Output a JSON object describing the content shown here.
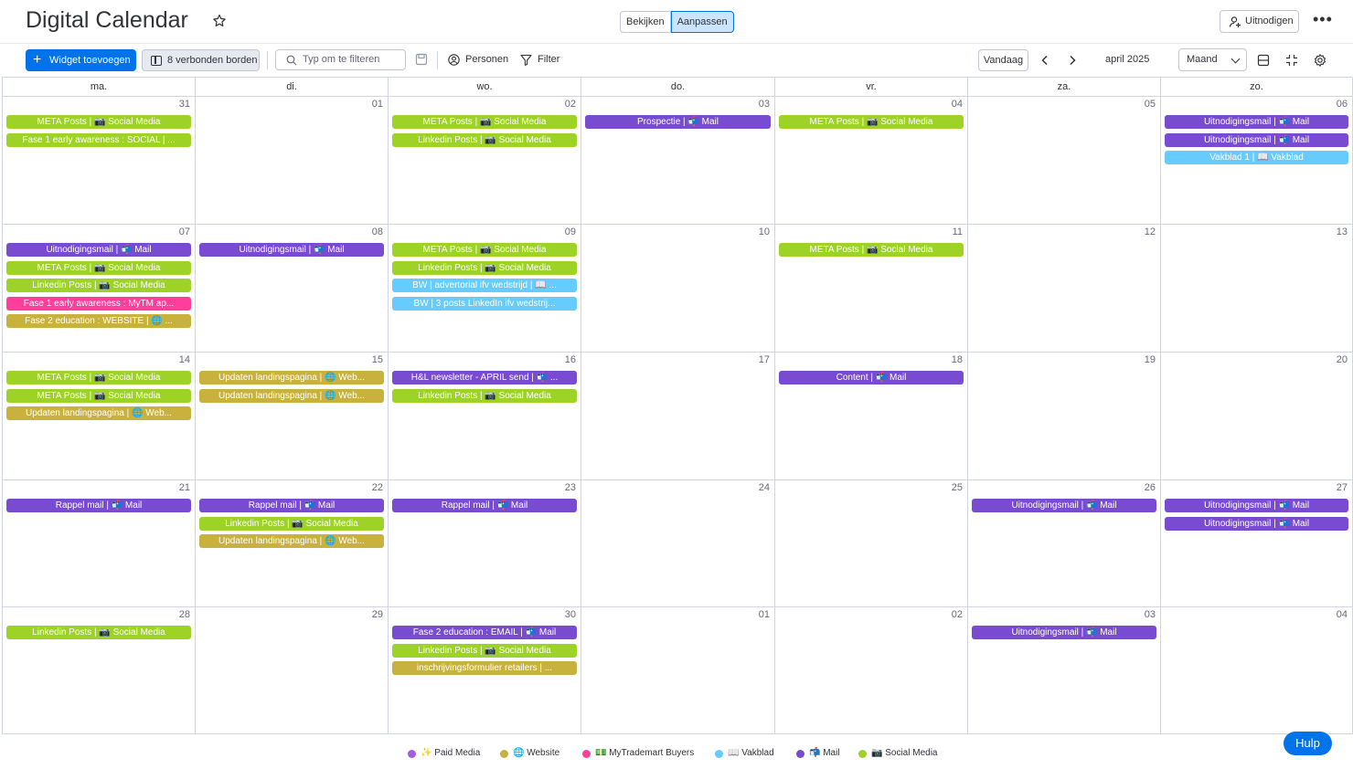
{
  "header": {
    "title": "Digital Calendar",
    "view_toggle": [
      "Bekijken",
      "Aanpassen"
    ],
    "invite_label": "Uitnodigen",
    "more_label": "•••"
  },
  "toolbar": {
    "add_widget_label": "Widget toevoegen",
    "connected_boards_label": "8 verbonden borden",
    "filter_placeholder": "Typ om te filteren",
    "persons_label": "Personen",
    "filter_label": "Filter",
    "today_label": "Vandaag",
    "month_label": "april 2025",
    "view_select_value": "Maand"
  },
  "colors": {
    "social": "#9cd326",
    "mail": "#784bd1",
    "vakblad": "#66ccff",
    "mytrademart": "#ff3d9a",
    "website": "#c9b13d",
    "paid": "#a25ddc",
    "accent": "#0073ea"
  },
  "calendar": {
    "days_of_week": [
      "ma.",
      "di.",
      "wo.",
      "do.",
      "vr.",
      "za.",
      "zo."
    ],
    "weeks": [
      [
        {
          "day": "31",
          "events": [
            {
              "title": "META Posts |  📷  Social Media",
              "type": "social"
            },
            {
              "title": "Fase 1 early awareness : SOCIAL | ...",
              "type": "social"
            }
          ]
        },
        {
          "day": "01",
          "events": []
        },
        {
          "day": "02",
          "events": [
            {
              "title": "META Posts |  📷  Social Media",
              "type": "social"
            },
            {
              "title": "Linkedin Posts |  📷  Social Media",
              "type": "social"
            }
          ]
        },
        {
          "day": "03",
          "events": [
            {
              "title": "Prospectie |  📬  Mail",
              "type": "mail"
            }
          ]
        },
        {
          "day": "04",
          "events": [
            {
              "title": "META Posts |  📷  Social Media",
              "type": "social"
            }
          ]
        },
        {
          "day": "05",
          "events": []
        },
        {
          "day": "06",
          "events": [
            {
              "title": "Uitnodigingsmail |  📬  Mail",
              "type": "mail"
            },
            {
              "title": "Uitnodigingsmail |  📬  Mail",
              "type": "mail"
            },
            {
              "title": "Vakblad 1 |  📖  Vakblad",
              "type": "vakblad"
            }
          ]
        }
      ],
      [
        {
          "day": "07",
          "events": [
            {
              "title": "Uitnodigingsmail |  📬  Mail",
              "type": "mail"
            },
            {
              "title": "META Posts |  📷  Social Media",
              "type": "social"
            },
            {
              "title": "Linkedin Posts |  📷  Social Media",
              "type": "social"
            },
            {
              "title": "Fase 1 early awareness : MyTM ap...",
              "type": "mytrademart"
            },
            {
              "title": "Fase 2 education : WEBSITE |  🌐  ...",
              "type": "website"
            }
          ]
        },
        {
          "day": "08",
          "events": [
            {
              "title": "Uitnodigingsmail |  📬  Mail",
              "type": "mail"
            }
          ]
        },
        {
          "day": "09",
          "events": [
            {
              "title": "META Posts |  📷  Social Media",
              "type": "social"
            },
            {
              "title": "Linkedin Posts |  📷  Social Media",
              "type": "social"
            },
            {
              "title": "BW | advertorial ifv wedstrijd |  📖  ...",
              "type": "vakblad"
            },
            {
              "title": "BW | 3 posts LinkedIn ifv wedstrij...",
              "type": "vakblad"
            }
          ]
        },
        {
          "day": "10",
          "events": []
        },
        {
          "day": "11",
          "events": [
            {
              "title": "META Posts |  📷  Social Media",
              "type": "social"
            }
          ]
        },
        {
          "day": "12",
          "events": []
        },
        {
          "day": "13",
          "events": []
        }
      ],
      [
        {
          "day": "14",
          "events": [
            {
              "title": "META Posts |  📷  Social Media",
              "type": "social"
            },
            {
              "title": "META Posts |  📷  Social Media",
              "type": "social"
            },
            {
              "title": "Updaten landingspagina |  🌐  Web...",
              "type": "website"
            }
          ]
        },
        {
          "day": "15",
          "events": [
            {
              "title": "Updaten landingspagina |  🌐  Web...",
              "type": "website"
            },
            {
              "title": "Updaten landingspagina |  🌐  Web...",
              "type": "website"
            }
          ]
        },
        {
          "day": "16",
          "events": [
            {
              "title": "H&L newsletter - APRIL send |  📬  ...",
              "type": "mail"
            },
            {
              "title": "Linkedin Posts |  📷  Social Media",
              "type": "social"
            }
          ]
        },
        {
          "day": "17",
          "events": []
        },
        {
          "day": "18",
          "events": [
            {
              "title": "Content |  📬  Mail",
              "type": "mail"
            }
          ]
        },
        {
          "day": "19",
          "events": []
        },
        {
          "day": "20",
          "events": []
        }
      ],
      [
        {
          "day": "21",
          "events": [
            {
              "title": "Rappel mail |  📬  Mail",
              "type": "mail"
            }
          ]
        },
        {
          "day": "22",
          "events": [
            {
              "title": "Rappel mail |  📬  Mail",
              "type": "mail"
            },
            {
              "title": "Linkedin Posts |  📷  Social Media",
              "type": "social"
            },
            {
              "title": "Updaten landingspagina |  🌐  Web...",
              "type": "website"
            }
          ]
        },
        {
          "day": "23",
          "events": [
            {
              "title": "Rappel mail |  📬  Mail",
              "type": "mail"
            }
          ]
        },
        {
          "day": "24",
          "events": []
        },
        {
          "day": "25",
          "events": []
        },
        {
          "day": "26",
          "events": [
            {
              "title": "Uitnodigingsmail |  📬  Mail",
              "type": "mail"
            }
          ]
        },
        {
          "day": "27",
          "events": [
            {
              "title": "Uitnodigingsmail |  📬  Mail",
              "type": "mail"
            },
            {
              "title": "Uitnodigingsmail |  📬  Mail",
              "type": "mail"
            }
          ]
        }
      ],
      [
        {
          "day": "28",
          "events": [
            {
              "title": "Linkedin Posts |  📷  Social Media",
              "type": "social"
            }
          ]
        },
        {
          "day": "29",
          "events": []
        },
        {
          "day": "30",
          "events": [
            {
              "title": "Fase 2 education : EMAIL |  📬  Mail",
              "type": "mail"
            },
            {
              "title": "Linkedin Posts |  📷  Social Media",
              "type": "social"
            },
            {
              "title": "inschrijvingsformulier retailers | ...",
              "type": "website"
            }
          ]
        },
        {
          "day": "01",
          "events": []
        },
        {
          "day": "02",
          "events": []
        },
        {
          "day": "03",
          "events": [
            {
              "title": "Uitnodigingsmail |  📬  Mail",
              "type": "mail"
            }
          ]
        },
        {
          "day": "04",
          "events": []
        }
      ]
    ]
  },
  "legend": [
    {
      "label": "✨ Paid Media",
      "type": "paid"
    },
    {
      "label": "🌐 Website",
      "type": "website"
    },
    {
      "label": "💵 MyTrademart Buyers",
      "type": "mytrademart"
    },
    {
      "label": "📖 Vakblad",
      "type": "vakblad"
    },
    {
      "label": "📬 Mail",
      "type": "mail"
    },
    {
      "label": "📷 Social Media",
      "type": "social"
    }
  ],
  "help_label": "Hulp",
  "icons": [
    "star-icon",
    "invite-person-icon",
    "more-icon",
    "plus-icon",
    "board-icon",
    "search-icon",
    "save-icon",
    "person-icon",
    "filter-icon",
    "chevron-left-icon",
    "chevron-right-icon",
    "chevron-down-icon",
    "collapse-icon",
    "fullscreen-icon",
    "settings-icon"
  ]
}
